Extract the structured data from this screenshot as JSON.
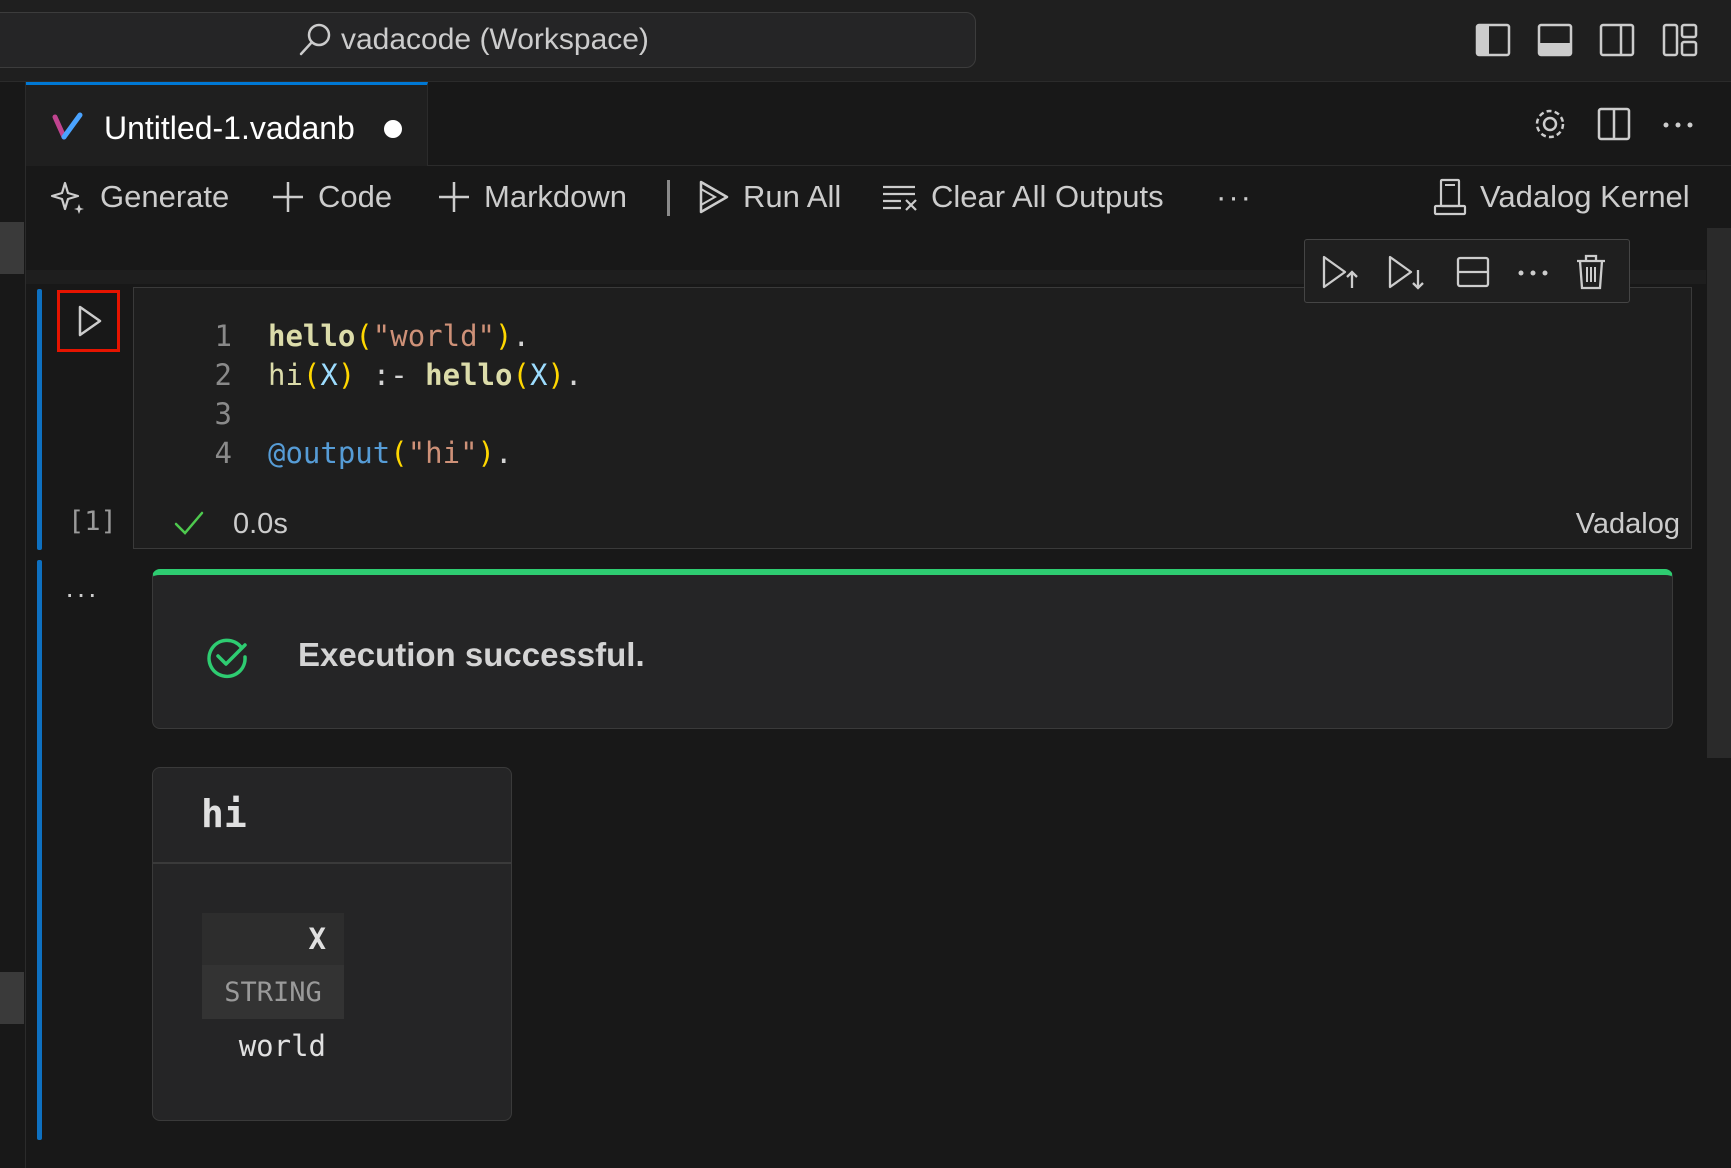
{
  "titlebar": {
    "search_text": "vadacode (Workspace)",
    "layout_icons": [
      "toggle-primary-sidebar-icon",
      "toggle-panel-icon",
      "toggle-secondary-sidebar-icon",
      "customize-layout-icon"
    ]
  },
  "tab": {
    "label": "Untitled-1.vadanb",
    "dirty": true
  },
  "toolbar": {
    "generate": "Generate",
    "code": "Code",
    "markdown": "Markdown",
    "run_all": "Run All",
    "clear_all_outputs": "Clear All Outputs",
    "more": "···",
    "kernel": "Vadalog Kernel"
  },
  "cell": {
    "lines": [
      {
        "n": "1",
        "parts": [
          [
            "fn",
            "hello"
          ],
          [
            "pn",
            "("
          ],
          [
            "str",
            "\"world\""
          ],
          [
            "pn",
            ")"
          ],
          [
            "op",
            "."
          ]
        ]
      },
      {
        "n": "2",
        "parts": [
          [
            "fn2",
            "hi"
          ],
          [
            "pn",
            "("
          ],
          [
            "var",
            "X"
          ],
          [
            "pn",
            ")"
          ],
          [
            "op",
            " :- "
          ],
          [
            "fn",
            "hello"
          ],
          [
            "pn",
            "("
          ],
          [
            "var",
            "X"
          ],
          [
            "pn",
            ")"
          ],
          [
            "op",
            "."
          ]
        ]
      },
      {
        "n": "3",
        "parts": []
      },
      {
        "n": "4",
        "parts": [
          [
            "dir",
            "@output"
          ],
          [
            "pn",
            "("
          ],
          [
            "str",
            "\"hi\""
          ],
          [
            "pn",
            ")"
          ],
          [
            "op",
            "."
          ]
        ]
      }
    ],
    "execution_count": "[1]",
    "duration": "0.0s",
    "language": "Vadalog",
    "status": "success"
  },
  "output": {
    "more": "···",
    "banner_text": "Execution successful.",
    "result_title": "hi",
    "table": {
      "column": "X",
      "type": "STRING",
      "rows": [
        "world"
      ]
    }
  },
  "colors": {
    "accent": "#0078d4",
    "success": "#2ecc71",
    "highlight_border": "#e51400"
  }
}
